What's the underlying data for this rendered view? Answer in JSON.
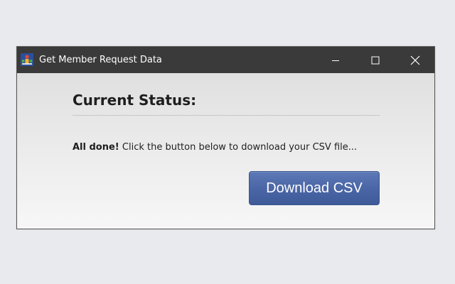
{
  "window": {
    "title": "Get Member Request Data",
    "icon": "app-icon",
    "controls": {
      "minimize_icon": "minimize-icon",
      "maximize_icon": "maximize-icon",
      "close_icon": "close-icon"
    }
  },
  "main": {
    "heading": "Current Status:",
    "status_bold": "All done!",
    "status_text": "Click the button below to download your CSV file...",
    "download_label": "Download CSV"
  },
  "colors": {
    "titlebar": "#3a3a3a",
    "button": "#4a65a5",
    "page_background": "#e9eaee"
  }
}
